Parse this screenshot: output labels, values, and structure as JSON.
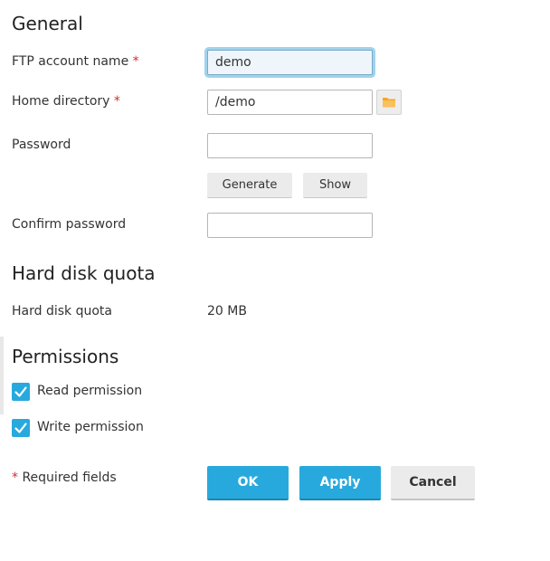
{
  "general": {
    "title": "General",
    "ftp_account": {
      "label": "FTP account name",
      "value": "demo"
    },
    "home_directory": {
      "label": "Home directory",
      "value": "/demo"
    },
    "password": {
      "label": "Password",
      "value": ""
    },
    "generate_label": "Generate",
    "show_label": "Show",
    "confirm_password": {
      "label": "Confirm password",
      "value": ""
    },
    "required_mark": "*"
  },
  "quota": {
    "title": "Hard disk quota",
    "label": "Hard disk quota",
    "value": "20 MB"
  },
  "permissions": {
    "title": "Permissions",
    "read": {
      "label": "Read permission",
      "checked": true
    },
    "write": {
      "label": "Write permission",
      "checked": true
    }
  },
  "footer": {
    "required_mark": "*",
    "required_text": "Required fields",
    "ok_label": "OK",
    "apply_label": "Apply",
    "cancel_label": "Cancel"
  },
  "colors": {
    "primary": "#28a9de",
    "required": "#d02e2e",
    "focus_ring": "#9fd3ee",
    "folder_icon": "#f5a623"
  },
  "icons": [
    "folder-icon",
    "checkmark-icon"
  ]
}
